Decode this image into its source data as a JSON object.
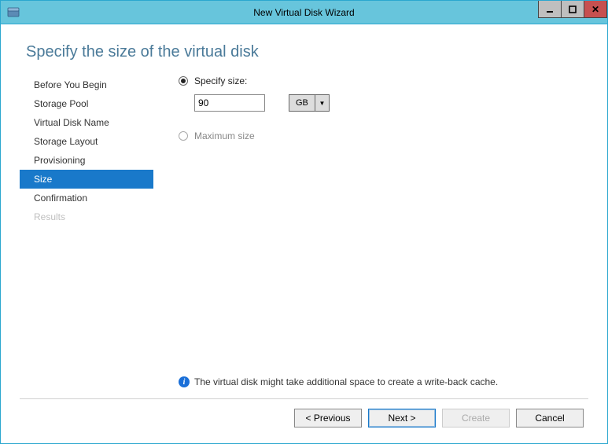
{
  "window": {
    "title": "New Virtual Disk Wizard"
  },
  "page": {
    "heading": "Specify the size of the virtual disk"
  },
  "sidebar": {
    "items": [
      {
        "label": "Before You Begin",
        "state": "normal"
      },
      {
        "label": "Storage Pool",
        "state": "normal"
      },
      {
        "label": "Virtual Disk Name",
        "state": "normal"
      },
      {
        "label": "Storage Layout",
        "state": "normal"
      },
      {
        "label": "Provisioning",
        "state": "normal"
      },
      {
        "label": "Size",
        "state": "selected"
      },
      {
        "label": "Confirmation",
        "state": "normal"
      },
      {
        "label": "Results",
        "state": "disabled"
      }
    ]
  },
  "options": {
    "specify_label": "Specify size:",
    "size_value": "90",
    "size_unit": "GB",
    "maximum_label": "Maximum size",
    "selected": "specify"
  },
  "info": {
    "text": "The virtual disk might take additional space to create a write-back cache."
  },
  "footer": {
    "previous": "< Previous",
    "next": "Next >",
    "create": "Create",
    "cancel": "Cancel"
  }
}
